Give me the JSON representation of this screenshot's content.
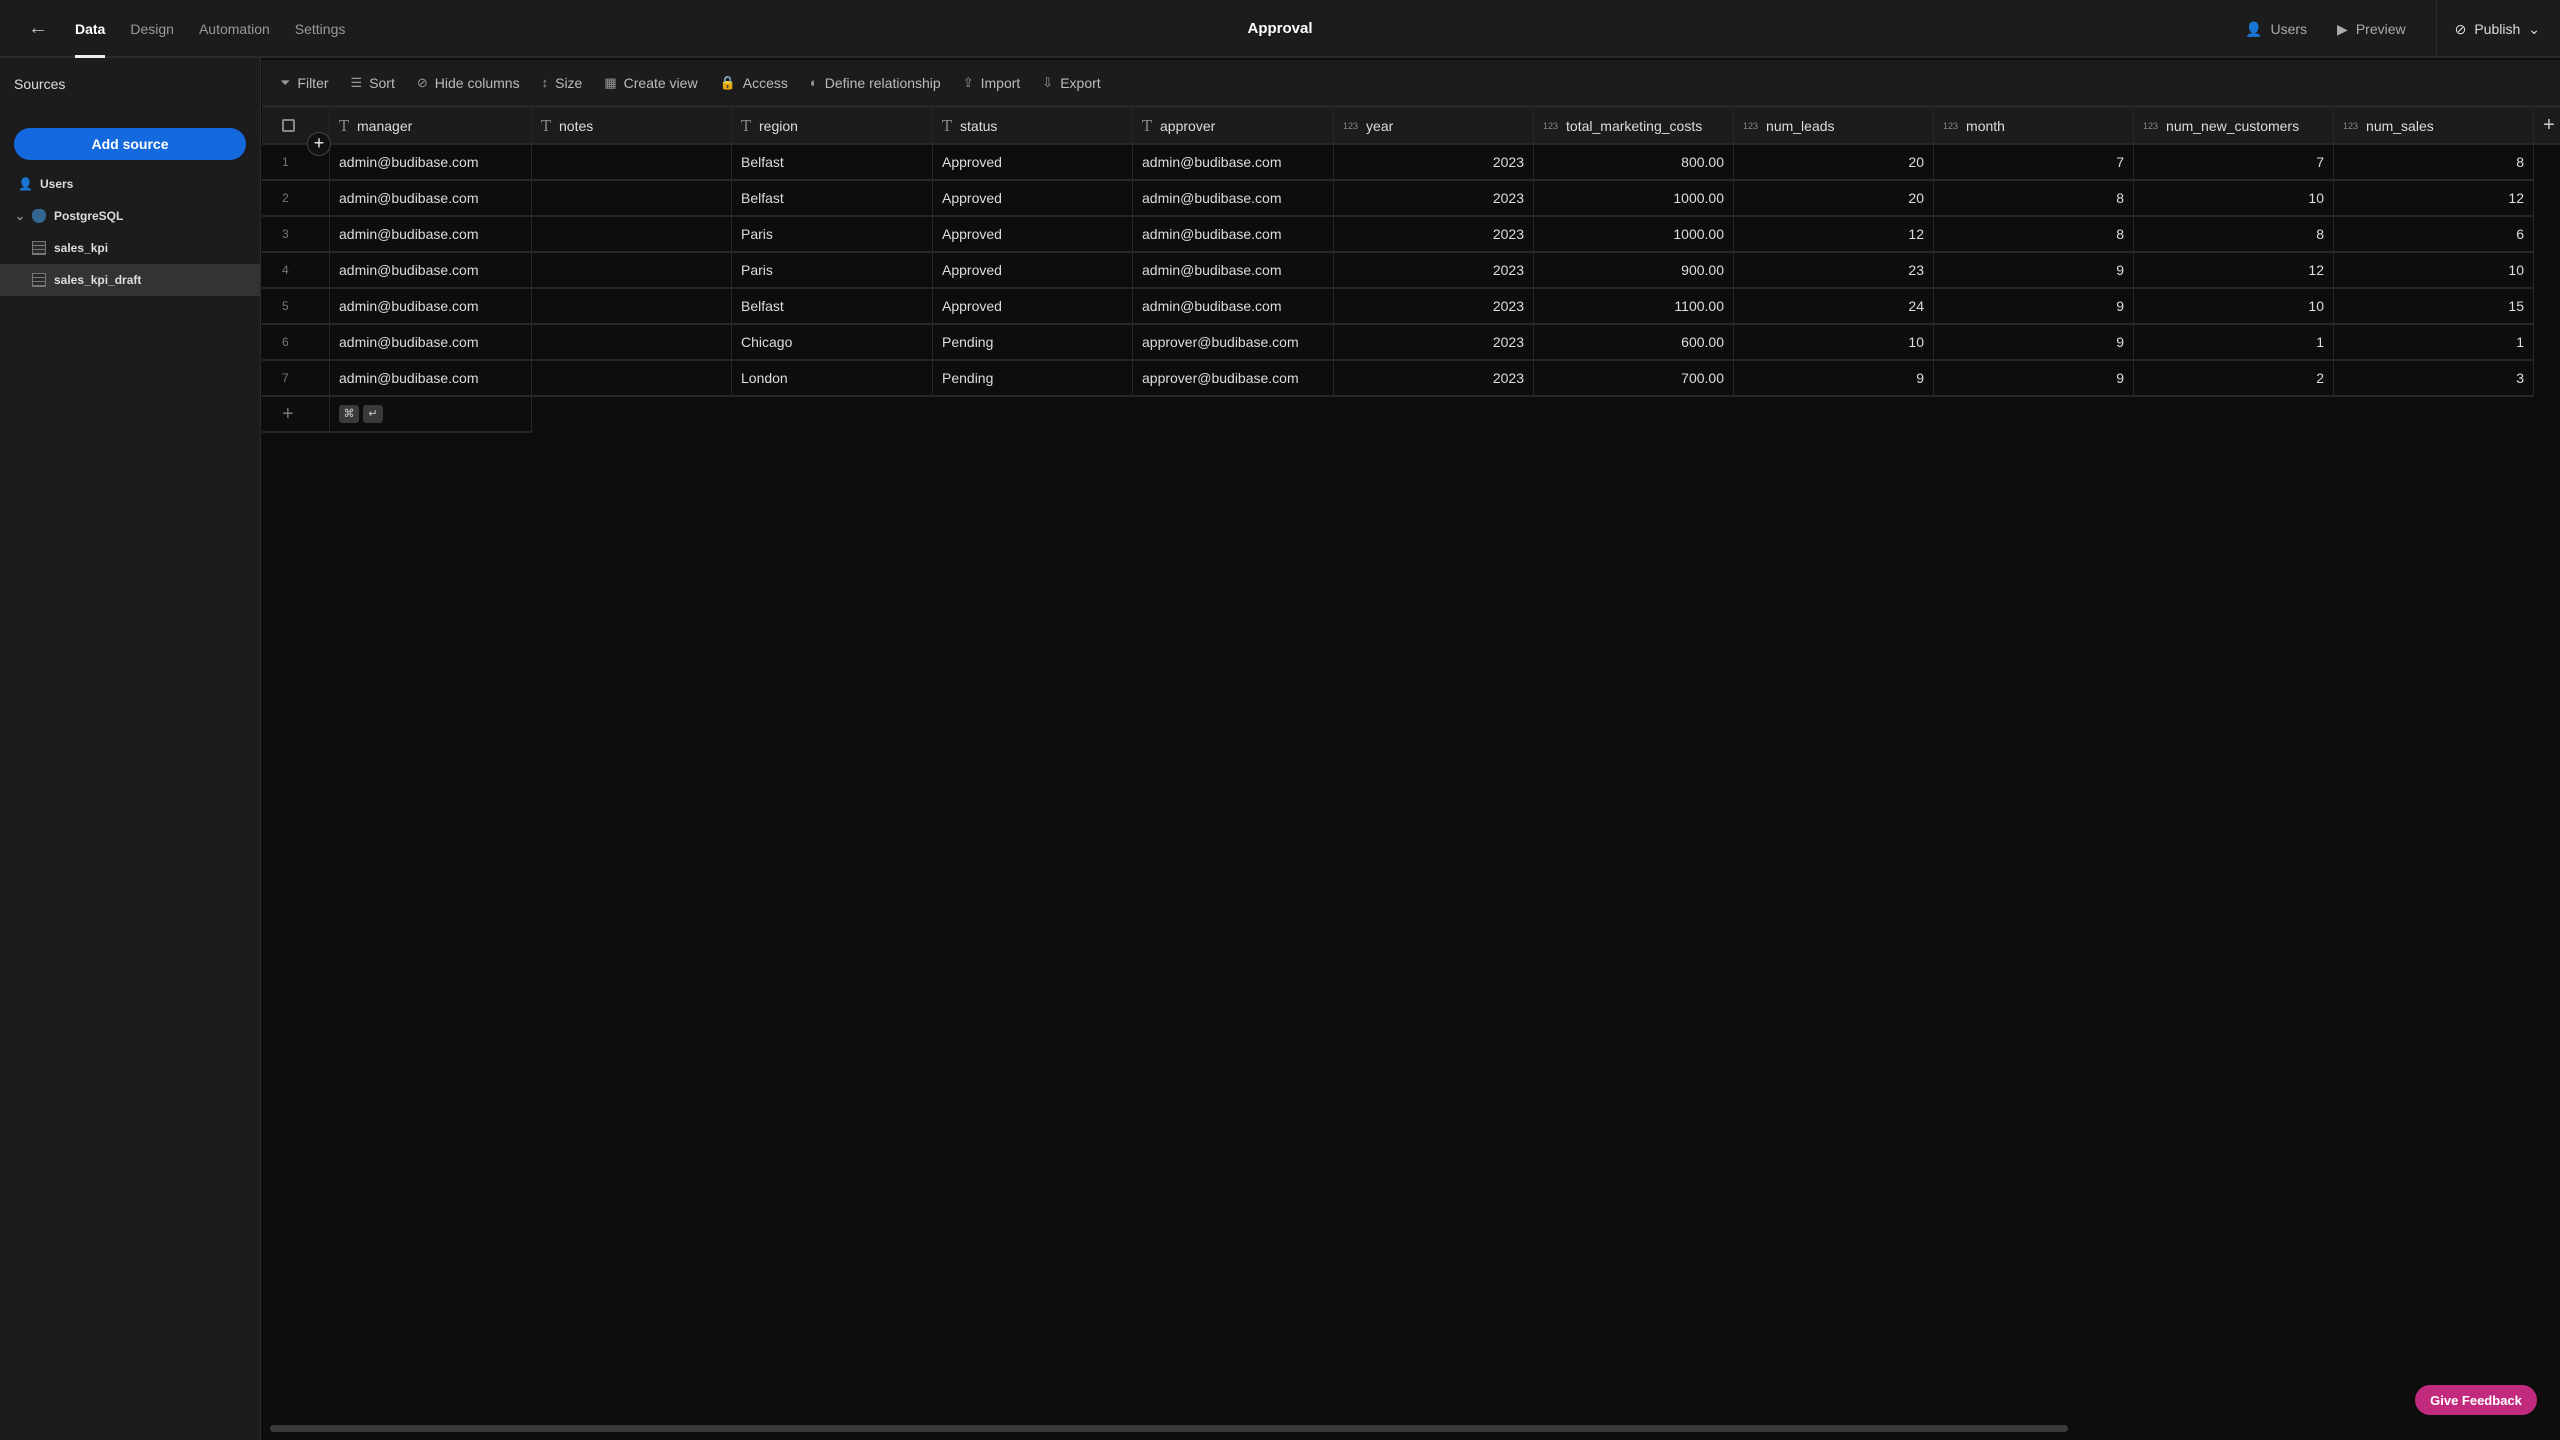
{
  "topbar": {
    "title": "Approval",
    "tabs": [
      "Data",
      "Design",
      "Automation",
      "Settings"
    ],
    "active_tab": "Data",
    "users": "Users",
    "preview": "Preview",
    "publish": "Publish"
  },
  "sidebar": {
    "heading": "Sources",
    "add_source": "Add source",
    "items": [
      {
        "label": "Users",
        "icon": "users-icon"
      },
      {
        "label": "PostgreSQL",
        "icon": "postgresql-icon"
      },
      {
        "label": "sales_kpi",
        "icon": "table-icon"
      },
      {
        "label": "sales_kpi_draft",
        "icon": "table-icon",
        "selected": true
      }
    ]
  },
  "toolbar": [
    {
      "label": "Filter",
      "icon": "filter-icon",
      "g": "⏷"
    },
    {
      "label": "Sort",
      "icon": "sort-icon",
      "g": "☰"
    },
    {
      "label": "Hide columns",
      "icon": "eye-off-icon",
      "g": "⊘"
    },
    {
      "label": "Size",
      "icon": "size-icon",
      "g": "↕"
    },
    {
      "label": "Create view",
      "icon": "view-icon",
      "g": "▦"
    },
    {
      "label": "Access",
      "icon": "lock-icon",
      "g": "🔒"
    },
    {
      "label": "Define relationship",
      "icon": "relationship-icon",
      "g": "◐"
    },
    {
      "label": "Import",
      "icon": "import-icon",
      "g": "⇪"
    },
    {
      "label": "Export",
      "icon": "export-icon",
      "g": "⇩"
    }
  ],
  "table": {
    "columns": [
      {
        "name": "manager",
        "type": "text"
      },
      {
        "name": "notes",
        "type": "text"
      },
      {
        "name": "region",
        "type": "text"
      },
      {
        "name": "status",
        "type": "text"
      },
      {
        "name": "approver",
        "type": "text"
      },
      {
        "name": "year",
        "type": "number"
      },
      {
        "name": "total_marketing_costs",
        "type": "number"
      },
      {
        "name": "num_leads",
        "type": "number"
      },
      {
        "name": "month",
        "type": "number"
      },
      {
        "name": "num_new_customers",
        "type": "number"
      },
      {
        "name": "num_sales",
        "type": "number"
      }
    ],
    "rows": [
      [
        "admin@budibase.com",
        "",
        "Belfast",
        "Approved",
        "admin@budibase.com",
        "2023",
        "800.00",
        "20",
        "7",
        "7",
        "8"
      ],
      [
        "admin@budibase.com",
        "",
        "Belfast",
        "Approved",
        "admin@budibase.com",
        "2023",
        "1000.00",
        "20",
        "8",
        "10",
        "12"
      ],
      [
        "admin@budibase.com",
        "",
        "Paris",
        "Approved",
        "admin@budibase.com",
        "2023",
        "1000.00",
        "12",
        "8",
        "8",
        "6"
      ],
      [
        "admin@budibase.com",
        "",
        "Paris",
        "Approved",
        "admin@budibase.com",
        "2023",
        "900.00",
        "23",
        "9",
        "12",
        "10"
      ],
      [
        "admin@budibase.com",
        "",
        "Belfast",
        "Approved",
        "admin@budibase.com",
        "2023",
        "1100.00",
        "24",
        "9",
        "10",
        "15"
      ],
      [
        "admin@budibase.com",
        "",
        "Chicago",
        "Pending",
        "approver@budibase.com",
        "2023",
        "600.00",
        "10",
        "9",
        "1",
        "1"
      ],
      [
        "admin@budibase.com",
        "",
        "London",
        "Pending",
        "approver@budibase.com",
        "2023",
        "700.00",
        "9",
        "9",
        "2",
        "3"
      ]
    ],
    "text_type_glyph": "T",
    "number_type_glyph": "123",
    "add_column": "+",
    "add_row": "+",
    "shortcut_keys": [
      "⌘",
      "↵"
    ]
  },
  "feedback": "Give Feedback",
  "colors": {
    "accent": "#1469de",
    "feedback": "#c22a7d",
    "bg": "#0d0d0d",
    "panel": "#1c1c1c"
  }
}
